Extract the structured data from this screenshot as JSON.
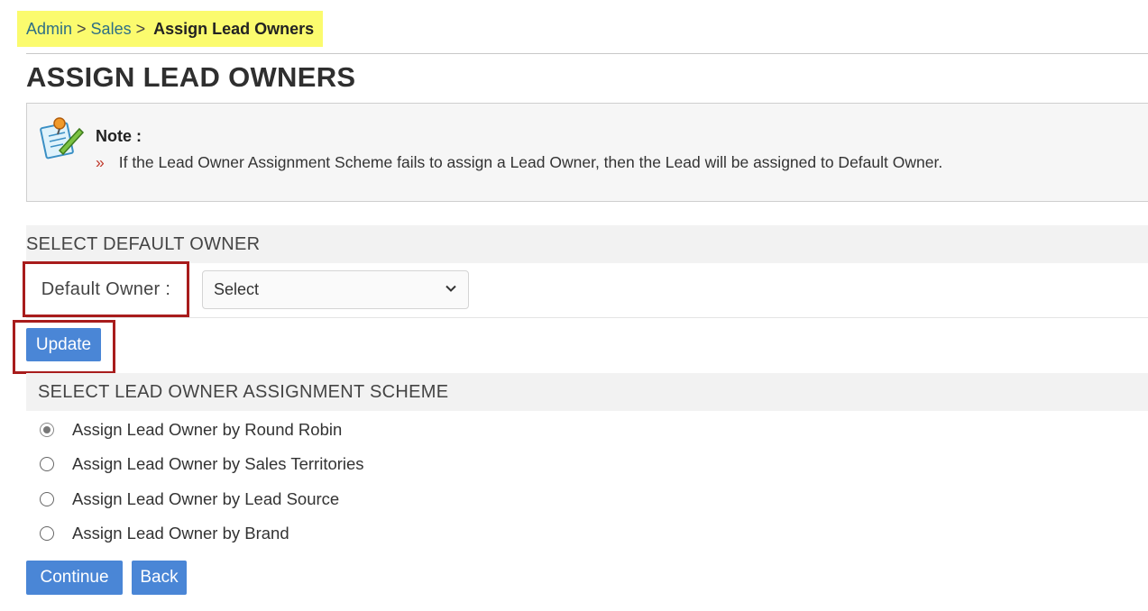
{
  "breadcrumb": {
    "items": [
      "Admin",
      "Sales"
    ],
    "separator": ">",
    "current": "Assign Lead Owners"
  },
  "page_title": "ASSIGN LEAD OWNERS",
  "note": {
    "label": "Note :",
    "bullet": "»",
    "text": "If the Lead Owner Assignment Scheme fails to assign a Lead Owner, then the Lead will be assigned to Default Owner."
  },
  "default_owner_section": {
    "heading": "SELECT DEFAULT OWNER",
    "label": "Default Owner :",
    "selected": "Select"
  },
  "buttons": {
    "update": "Update",
    "continue": "Continue",
    "back": "Back"
  },
  "scheme_section": {
    "heading": "SELECT LEAD OWNER ASSIGNMENT SCHEME",
    "options": [
      {
        "label": "Assign Lead Owner by Round Robin",
        "checked": true
      },
      {
        "label": "Assign Lead Owner by Sales Territories",
        "checked": false
      },
      {
        "label": "Assign Lead Owner by Lead Source",
        "checked": false
      },
      {
        "label": "Assign Lead Owner by Brand",
        "checked": false
      }
    ]
  },
  "colors": {
    "highlight": "#fbfb6e",
    "button": "#4a86d6",
    "annotation_border": "#a81c1c",
    "link": "#2e6f85"
  },
  "icons": {
    "note": "notepad-pin-icon",
    "dropdown": "chevron-down-icon"
  }
}
